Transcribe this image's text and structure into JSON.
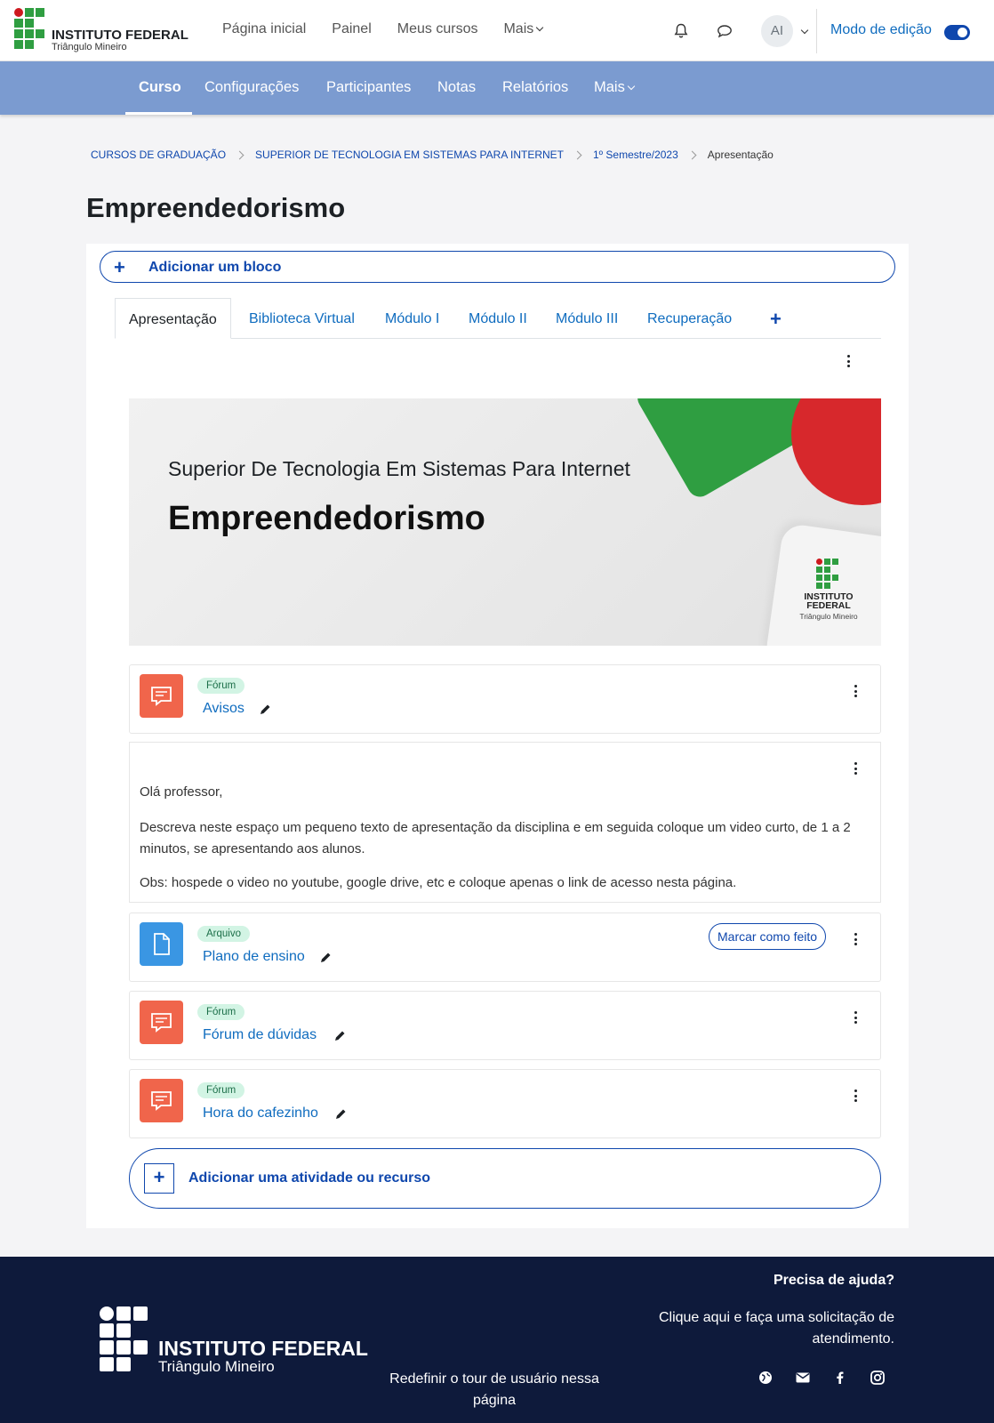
{
  "brand": {
    "title": "INSTITUTO FEDERAL",
    "subtitle": "Triângulo Mineiro"
  },
  "topnav": {
    "items": [
      {
        "label": "Página inicial"
      },
      {
        "label": "Painel"
      },
      {
        "label": "Meus cursos"
      },
      {
        "label": "Mais"
      }
    ],
    "avatar_initials": "AI",
    "edit_mode_label": "Modo de edição",
    "edit_mode_on": true
  },
  "secnav": {
    "items": [
      {
        "label": "Curso"
      },
      {
        "label": "Configurações"
      },
      {
        "label": "Participantes"
      },
      {
        "label": "Notas"
      },
      {
        "label": "Relatórios"
      },
      {
        "label": "Mais"
      }
    ]
  },
  "breadcrumb": [
    "CURSOS DE GRADUAÇÃO",
    "SUPERIOR DE TECNOLOGIA EM SISTEMAS PARA INTERNET",
    "1º Semestre/2023",
    "Apresentação"
  ],
  "page_title": "Empreendedorismo",
  "add_block_label": "Adicionar um bloco",
  "tabs": [
    {
      "label": "Apresentação"
    },
    {
      "label": "Biblioteca Virtual"
    },
    {
      "label": "Módulo I"
    },
    {
      "label": "Módulo II"
    },
    {
      "label": "Módulo III"
    },
    {
      "label": "Recuperação"
    },
    {
      "label": "+"
    }
  ],
  "banner": {
    "subtitle": "Superior De Tecnologia Em Sistemas Para Internet",
    "title": "Empreendedorismo",
    "logo_title": "INSTITUTO FEDERAL",
    "logo_subtitle": "Triângulo Mineiro"
  },
  "activities": [
    {
      "type": "Fórum",
      "name": "Avisos",
      "icon": "forum-icon"
    },
    {
      "type": "Arquivo",
      "name": "Plano de ensino",
      "icon": "file-icon",
      "action": "Marcar como feito"
    },
    {
      "type": "Fórum",
      "name": "Fórum de dúvidas",
      "icon": "forum-icon"
    },
    {
      "type": "Fórum",
      "name": "Hora do cafezinho",
      "icon": "forum-icon"
    }
  ],
  "text_block": {
    "greeting": "Olá professor,",
    "paragraph": "Descreva neste espaço um pequeno texto de apresentação da disciplina e em seguida coloque um video curto, de 1 a 2 minutos, se apresentando aos alunos.",
    "note": "Obs: hospede o video no youtube, google drive, etc e coloque apenas o link de acesso nesta página."
  },
  "add_activity_label": "Adicionar uma atividade ou recurso",
  "footer": {
    "logo_title": "INSTITUTO FEDERAL",
    "logo_subtitle": "Triângulo Mineiro",
    "tour_text": "Redefinir o tour de usuário nessa página",
    "help_title": "Precisa de ajuda?",
    "help_text": "Clique aqui e faça uma solicitação de atendimento.",
    "social": [
      "globe-icon",
      "mail-icon",
      "facebook-icon",
      "instagram-icon"
    ]
  },
  "colors": {
    "primary": "#0f47ad",
    "secnav_bg": "#7b9bd0",
    "forum_icon_bg": "#f0654b",
    "file_icon_bg": "#3a96e3",
    "badge_bg": "#d2f4e4",
    "footer_bg": "#0e1a3b"
  }
}
